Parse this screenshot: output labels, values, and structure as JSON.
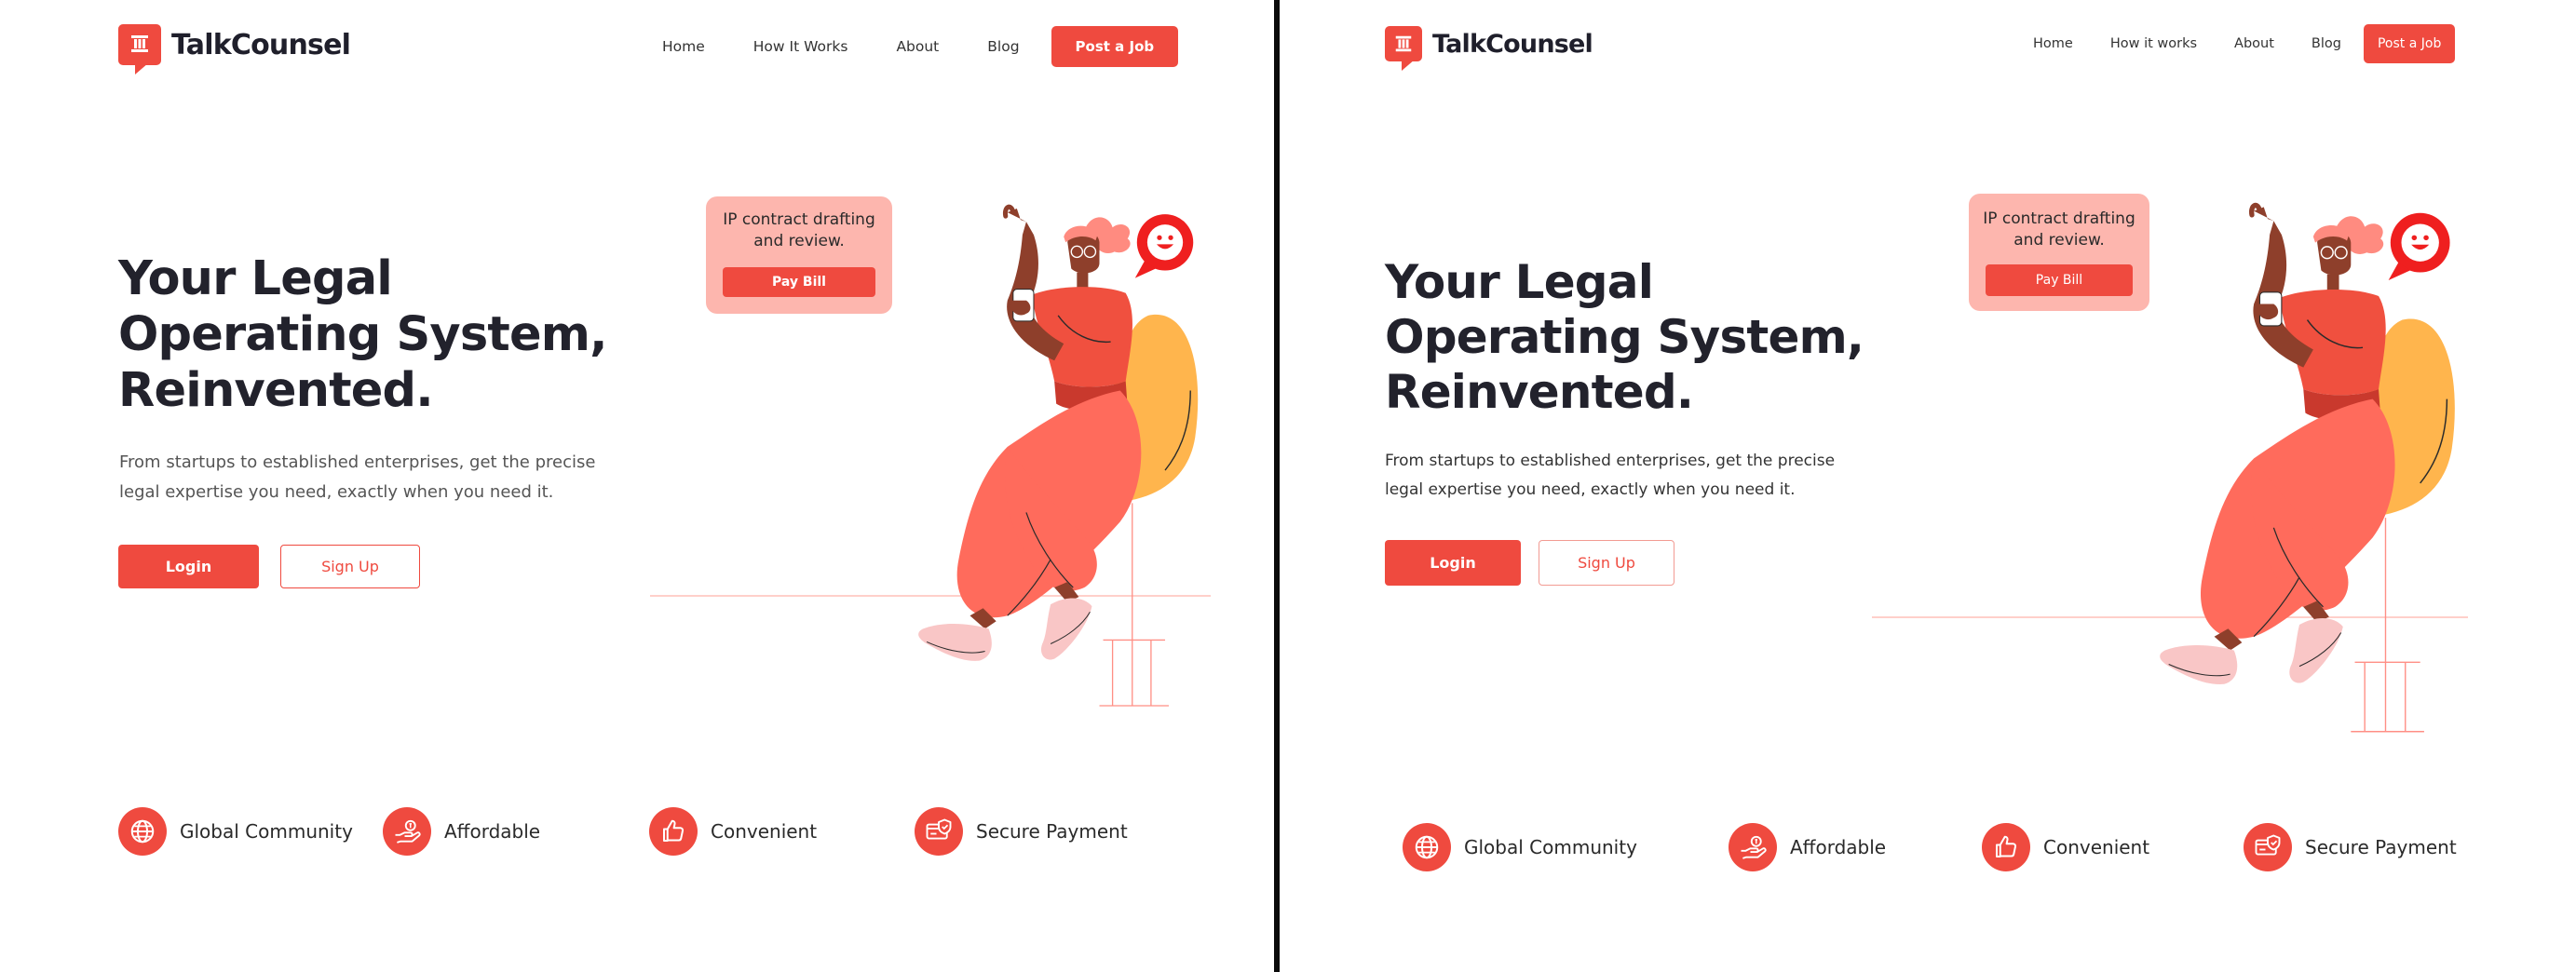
{
  "panels": [
    {
      "brand": {
        "name": "TalkCounsel",
        "logo_icon": "pillar-chat-icon"
      },
      "nav": {
        "home": "Home",
        "how": "How It Works",
        "about": "About",
        "blog": "Blog",
        "cta": "Post a Job"
      },
      "hero": {
        "title_lines": [
          "Your Legal",
          "Operating System,",
          "Reinvented."
        ],
        "subtitle_lines": [
          "From startups to established enterprises, get the precise",
          "legal expertise you need, exactly when you need it."
        ],
        "login": "Login",
        "signup": "Sign Up"
      },
      "card": {
        "text_lines": [
          "IP contract drafting",
          "and review."
        ],
        "button": "Pay Bill"
      },
      "features": [
        {
          "label": "Global Community",
          "icon": "globe-icon"
        },
        {
          "label": "Affordable",
          "icon": "hand-coin-icon"
        },
        {
          "label": "Convenient",
          "icon": "thumbs-up-icon"
        },
        {
          "label": "Secure Payment",
          "icon": "secure-card-icon"
        }
      ]
    },
    {
      "brand": {
        "name": "TalkCounsel",
        "logo_icon": "pillar-chat-icon"
      },
      "nav": {
        "home": "Home",
        "how": "How it works",
        "about": "About",
        "blog": "Blog",
        "cta": "Post a Job"
      },
      "hero": {
        "title_lines": [
          "Your Legal",
          "Operating System,",
          "Reinvented."
        ],
        "subtitle_lines": [
          "From startups to established enterprises, get the precise",
          "legal expertise you need, exactly when you need it."
        ],
        "login": "Login",
        "signup": "Sign Up"
      },
      "card": {
        "text_lines": [
          "IP contract drafting",
          "and review."
        ],
        "button": "Pay Bill"
      },
      "features": [
        {
          "label": "Global Community",
          "icon": "globe-icon"
        },
        {
          "label": "Affordable",
          "icon": "hand-coin-icon"
        },
        {
          "label": "Convenient",
          "icon": "thumbs-up-icon"
        },
        {
          "label": "Secure Payment",
          "icon": "secure-card-icon"
        }
      ]
    }
  ],
  "colors": {
    "accent": "#ef4a3f",
    "card_bg": "#fdb6ae",
    "chair": "#ffb54d",
    "pants": "#ff6b5c",
    "skin": "#8e3f2b",
    "hair": "#ff8b80",
    "shoes": "#f9c6c6",
    "heading": "#22222c"
  }
}
